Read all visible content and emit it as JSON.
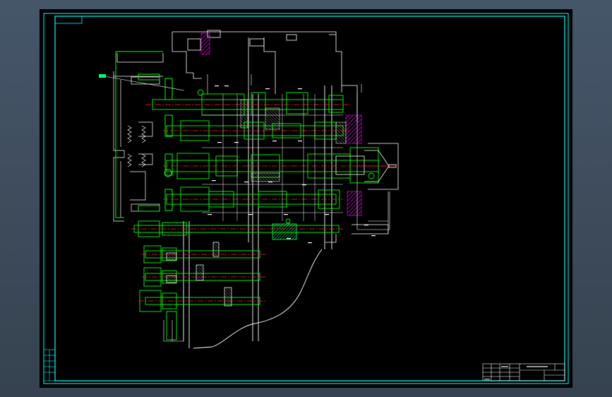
{
  "colors": {
    "desktop_bg": "#3c4a5c",
    "canvas_bg": "#000000",
    "frame_line": "#00ffff",
    "part_line": "#00ff00",
    "outline_line": "#ffffff",
    "center_line": "#ff2020",
    "hatch": "#ff00ff",
    "highlight": "#00ff66"
  },
  "drawing": {
    "kind": "gearbox-assembly-section",
    "shafts_horizontal": 5,
    "shafts_lower": 4,
    "gear_blocks_hatched": 3
  },
  "title_block": {
    "rows": 4,
    "columns": 6
  },
  "side_stamp": {
    "cells": 5
  }
}
